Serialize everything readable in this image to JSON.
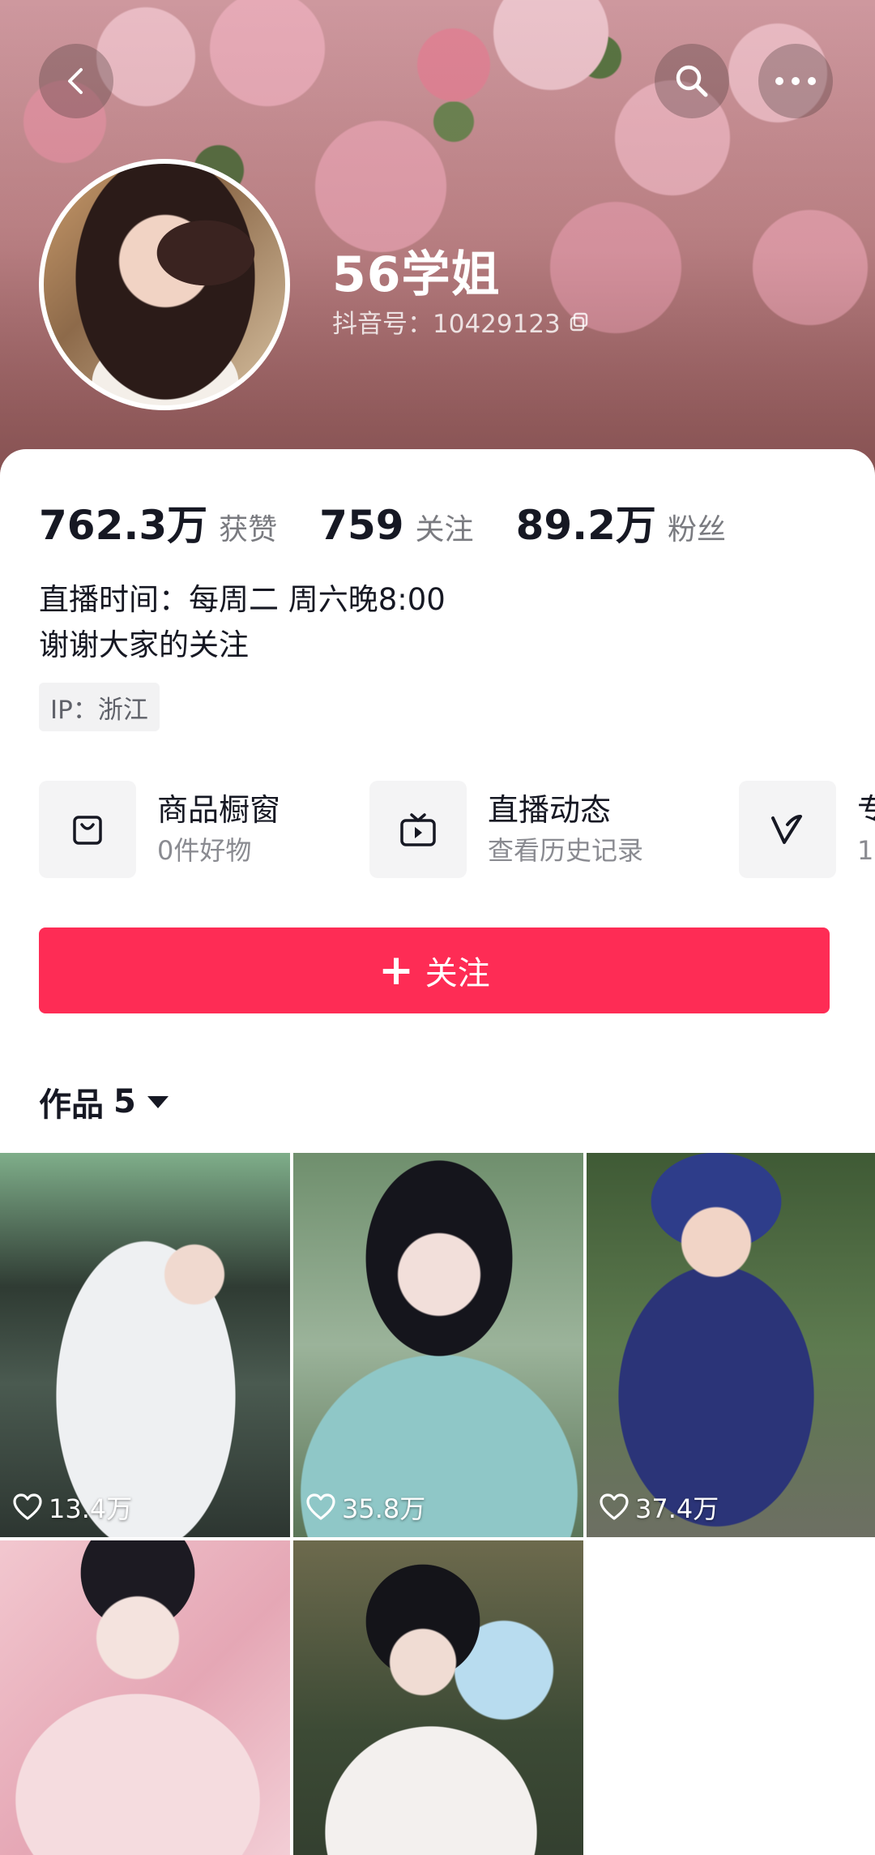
{
  "profile": {
    "name": "56学姐",
    "douyin_id": "抖音号：10429123",
    "stats": [
      {
        "value": "762.3万",
        "label": "获赞"
      },
      {
        "value": "759",
        "label": "关注"
      },
      {
        "value": "89.2万",
        "label": "粉丝"
      }
    ],
    "bio_line1": "直播时间：每周二 周六晚8:00",
    "bio_line2": "谢谢大家的关注",
    "ip": "IP：浙江"
  },
  "shortcuts": [
    {
      "title": "商品橱窗",
      "subtitle": "0件好物",
      "icon": "shopping-bag-icon"
    },
    {
      "title": "直播动态",
      "subtitle": "查看历史记录",
      "icon": "tv-icon"
    },
    {
      "title": "专",
      "subtitle": "1",
      "icon": "v-check-icon"
    }
  ],
  "follow_button": {
    "plus": "+",
    "label": "关注"
  },
  "works": {
    "label": "作品",
    "count": "5",
    "items": [
      {
        "likes": "13.4万"
      },
      {
        "likes": "35.8万"
      },
      {
        "likes": "37.4万"
      },
      {
        "likes": ""
      },
      {
        "likes": ""
      }
    ]
  },
  "colors": {
    "accent": "#fe2c55",
    "text": "#161823",
    "muted": "#7a7b80"
  }
}
